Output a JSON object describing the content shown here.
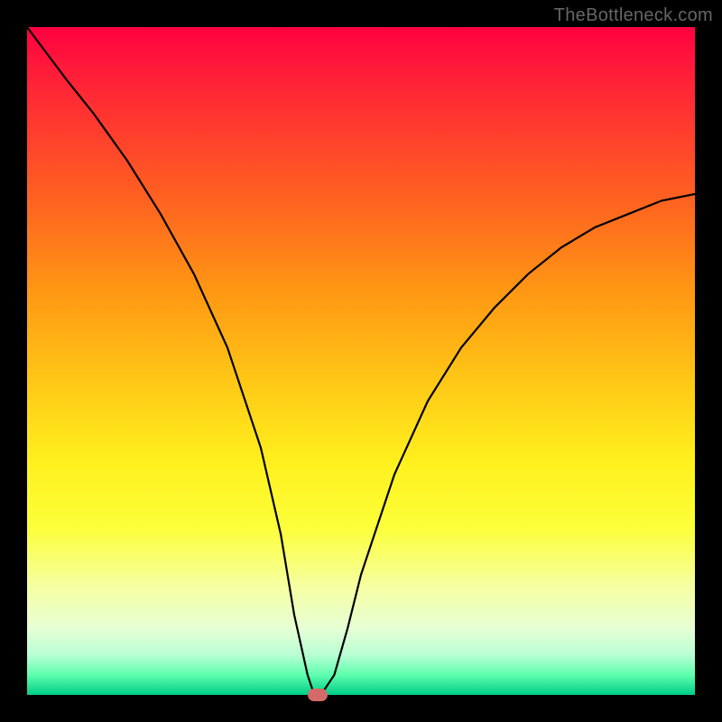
{
  "watermark": "TheBottleneck.com",
  "colors": {
    "frame": "#000000",
    "curve": "#000000",
    "marker": "#d46a6a",
    "gradient_top": "#ff0040",
    "gradient_bottom": "#00cc88"
  },
  "chart_data": {
    "type": "line",
    "title": "",
    "xlabel": "",
    "ylabel": "",
    "xlim": [
      0,
      100
    ],
    "ylim": [
      0,
      100
    ],
    "x": [
      0,
      3,
      6,
      10,
      15,
      20,
      25,
      30,
      35,
      38,
      40,
      42,
      43,
      44,
      46,
      48,
      50,
      55,
      60,
      65,
      70,
      75,
      80,
      85,
      90,
      95,
      100
    ],
    "y": [
      100,
      96,
      92,
      87,
      80,
      72,
      63,
      52,
      37,
      24,
      12,
      3,
      0,
      0,
      3,
      10,
      18,
      33,
      44,
      52,
      58,
      63,
      67,
      70,
      72,
      74,
      75
    ],
    "marker": {
      "x": 43.5,
      "y": 0
    },
    "note": "y is bottleneck % (high=red top, low=green bottom); curve reaches 0 near x≈43-44"
  }
}
